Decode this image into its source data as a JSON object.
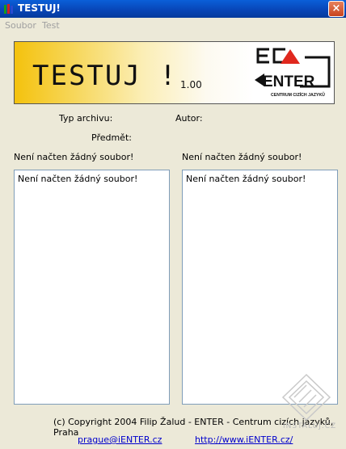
{
  "window": {
    "title": "TESTUJ!",
    "close_glyph": "×"
  },
  "menu": {
    "items": [
      {
        "label": "Soubor"
      },
      {
        "label": "Test"
      }
    ]
  },
  "banner": {
    "title": "TESTUJ !",
    "version": "1.00",
    "logo_text": "ENTER",
    "logo_subtitle": "CENTRUM CIZÍCH JAZYKŮ",
    "colors": {
      "gradient_start": "#f4c20d",
      "logo_red": "#e0281e"
    }
  },
  "info": {
    "archive_type_label": "Typ archivu:",
    "author_label": "Autor:",
    "subject_label": "Předmět:"
  },
  "left_panel": {
    "status": "Není načten žádný soubor!",
    "content": "Není načten žádný soubor!"
  },
  "right_panel": {
    "status": "Není načten žádný soubor!",
    "content": "Není načten žádný soubor!"
  },
  "footer": {
    "copyright": "(c) Copyright 2004 Filip Žalud - ENTER - Centrum cizích jazyků, Praha",
    "email": "prague@iENTER.cz",
    "website": "http://www.iENTER.cz/"
  },
  "watermark": {
    "text": "INSTALUJ.CZ"
  }
}
